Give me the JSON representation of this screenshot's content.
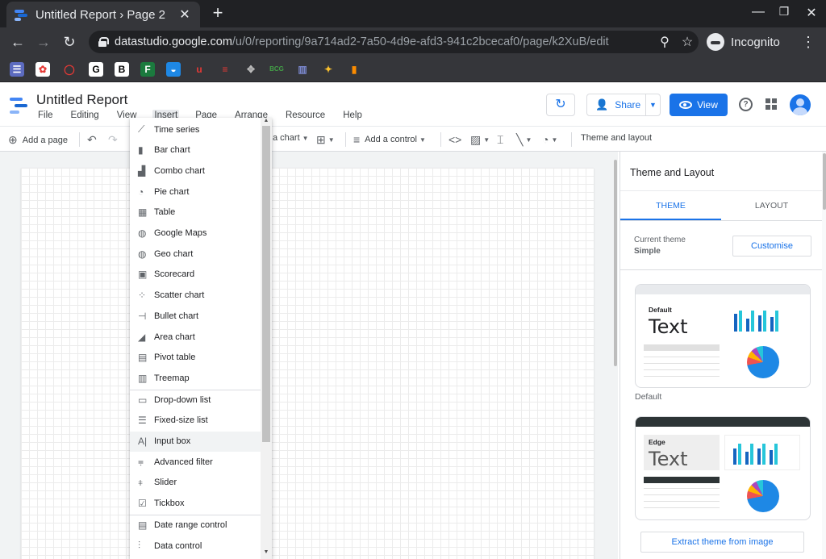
{
  "browser": {
    "tab_title": "Untitled Report › Page 2",
    "url_host": "datastudio.google.com",
    "url_path": "/u/0/reporting/9a714ad2-7a50-4d9e-afd3-941c2bcecaf0/page/k2XuB/edit",
    "profile_label": "Incognito"
  },
  "app": {
    "title": "Untitled Report",
    "menu": [
      "File",
      "Editing",
      "View",
      "Insert",
      "Page",
      "Arrange",
      "Resource",
      "Help"
    ],
    "share_label": "Share",
    "view_label": "View"
  },
  "toolbar": {
    "add_page": "Add a page",
    "add_chart": "a chart",
    "add_control": "Add a control",
    "theme_layout": "Theme and layout"
  },
  "insert_menu": {
    "groups": [
      [
        {
          "label": "Time series",
          "icon": "time-series-icon",
          "glyph": "⟋"
        },
        {
          "label": "Bar chart",
          "icon": "bar-chart-icon",
          "glyph": "▮"
        },
        {
          "label": "Combo chart",
          "icon": "combo-chart-icon",
          "glyph": "▟"
        },
        {
          "label": "Pie chart",
          "icon": "pie-chart-icon",
          "glyph": "◔"
        },
        {
          "label": "Table",
          "icon": "table-icon",
          "glyph": "▦"
        },
        {
          "label": "Google Maps",
          "icon": "globe-icon",
          "glyph": "◍"
        },
        {
          "label": "Geo chart",
          "icon": "geo-chart-icon",
          "glyph": "◍"
        },
        {
          "label": "Scorecard",
          "icon": "scorecard-icon",
          "glyph": "▣"
        },
        {
          "label": "Scatter chart",
          "icon": "scatter-chart-icon",
          "glyph": "⁘"
        },
        {
          "label": "Bullet chart",
          "icon": "bullet-chart-icon",
          "glyph": "⊣"
        },
        {
          "label": "Area chart",
          "icon": "area-chart-icon",
          "glyph": "◢"
        },
        {
          "label": "Pivot table",
          "icon": "pivot-table-icon",
          "glyph": "▤"
        },
        {
          "label": "Treemap",
          "icon": "treemap-icon",
          "glyph": "▥"
        }
      ],
      [
        {
          "label": "Drop-down list",
          "icon": "dropdown-list-icon",
          "glyph": "▭"
        },
        {
          "label": "Fixed-size list",
          "icon": "list-icon",
          "glyph": "☰"
        },
        {
          "label": "Input box",
          "icon": "input-box-icon",
          "glyph": "A|"
        },
        {
          "label": "Advanced filter",
          "icon": "filter-icon",
          "glyph": "⩦"
        },
        {
          "label": "Slider",
          "icon": "slider-icon",
          "glyph": "⧧"
        },
        {
          "label": "Tickbox",
          "icon": "checkbox-icon",
          "glyph": "☑"
        }
      ],
      [
        {
          "label": "Date range control",
          "icon": "calendar-icon",
          "glyph": "▤"
        },
        {
          "label": "Data control",
          "icon": "data-control-icon",
          "glyph": "⫶"
        }
      ]
    ],
    "highlighted": "Input box"
  },
  "panel": {
    "title": "Theme and Layout",
    "tabs": [
      "THEME",
      "LAYOUT"
    ],
    "current_theme_label": "Current theme",
    "current_theme_value": "Simple",
    "customise": "Customise",
    "themes": [
      {
        "name": "Default",
        "sample_text": "Text"
      },
      {
        "name": "Edge",
        "sample_text": "Text"
      }
    ],
    "extract": "Extract theme from image"
  },
  "colors": {
    "accent": "#1a73e8",
    "browser_dark": "#202124",
    "browser_mid": "#35363a"
  }
}
